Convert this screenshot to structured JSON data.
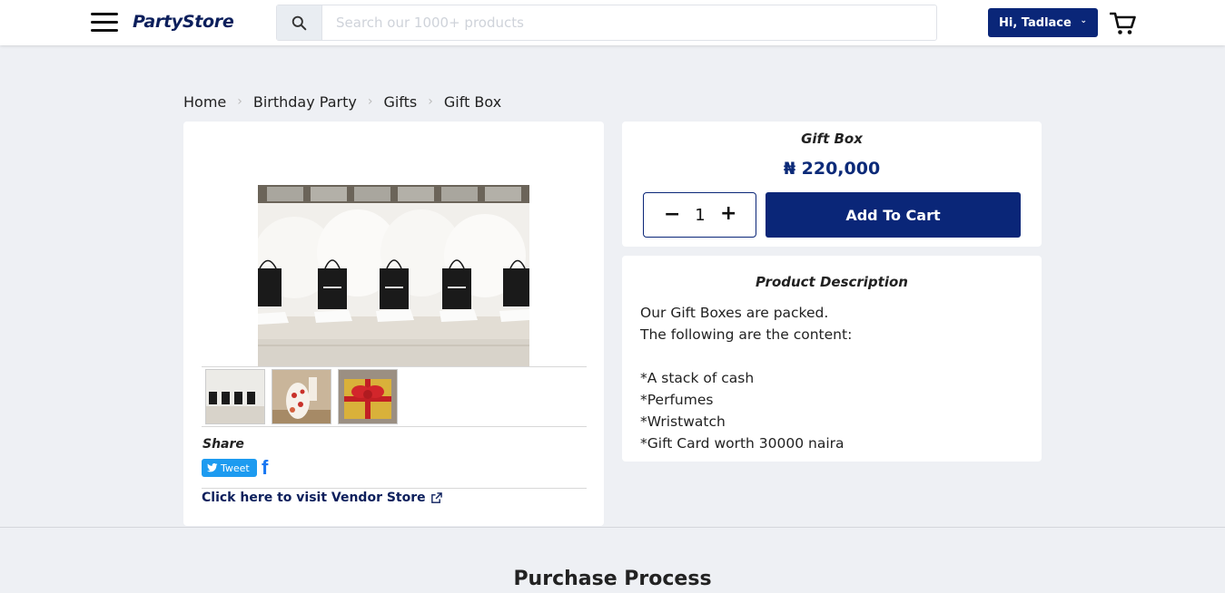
{
  "header": {
    "logo": "PartyStore",
    "search_placeholder": "Search our 1000+ products",
    "user_label": "Hi, Tadlace",
    "chevron": "⌄"
  },
  "icons": {
    "menu": "hamburger-menu-icon",
    "search": "search-icon",
    "user_chevron": "chevron-down-icon",
    "cart": "cart-icon",
    "twitter": "twitter-bird-icon",
    "facebook": "facebook-icon",
    "external": "external-link-icon"
  },
  "breadcrumb": {
    "items": [
      "Home",
      "Birthday Party",
      "Gifts",
      "Gift Box"
    ],
    "separator": "›"
  },
  "gallery": {
    "share_label": "Share",
    "tweet_label": "Tweet",
    "facebook_label": "f",
    "vendor_link": "Click here to visit Vendor Store"
  },
  "product": {
    "title": "Gift Box",
    "price": "₦ 220,000",
    "quantity": "1",
    "minus": "−",
    "plus": "+",
    "add_to_cart": "Add To Cart"
  },
  "description": {
    "title": "Product Description",
    "lines": [
      "Our Gift Boxes are packed.",
      "The following are the content:",
      "",
      "*A stack of cash",
      "*Perfumes",
      "*Wristwatch",
      "*Gift Card worth 30000 naira"
    ]
  },
  "section": {
    "title": "Purchase Process"
  },
  "colors": {
    "brand_navy": "#0a2678",
    "page_bg": "#eef0f4",
    "twitter_blue": "#1d9bf0",
    "facebook_blue": "#1877f2"
  }
}
